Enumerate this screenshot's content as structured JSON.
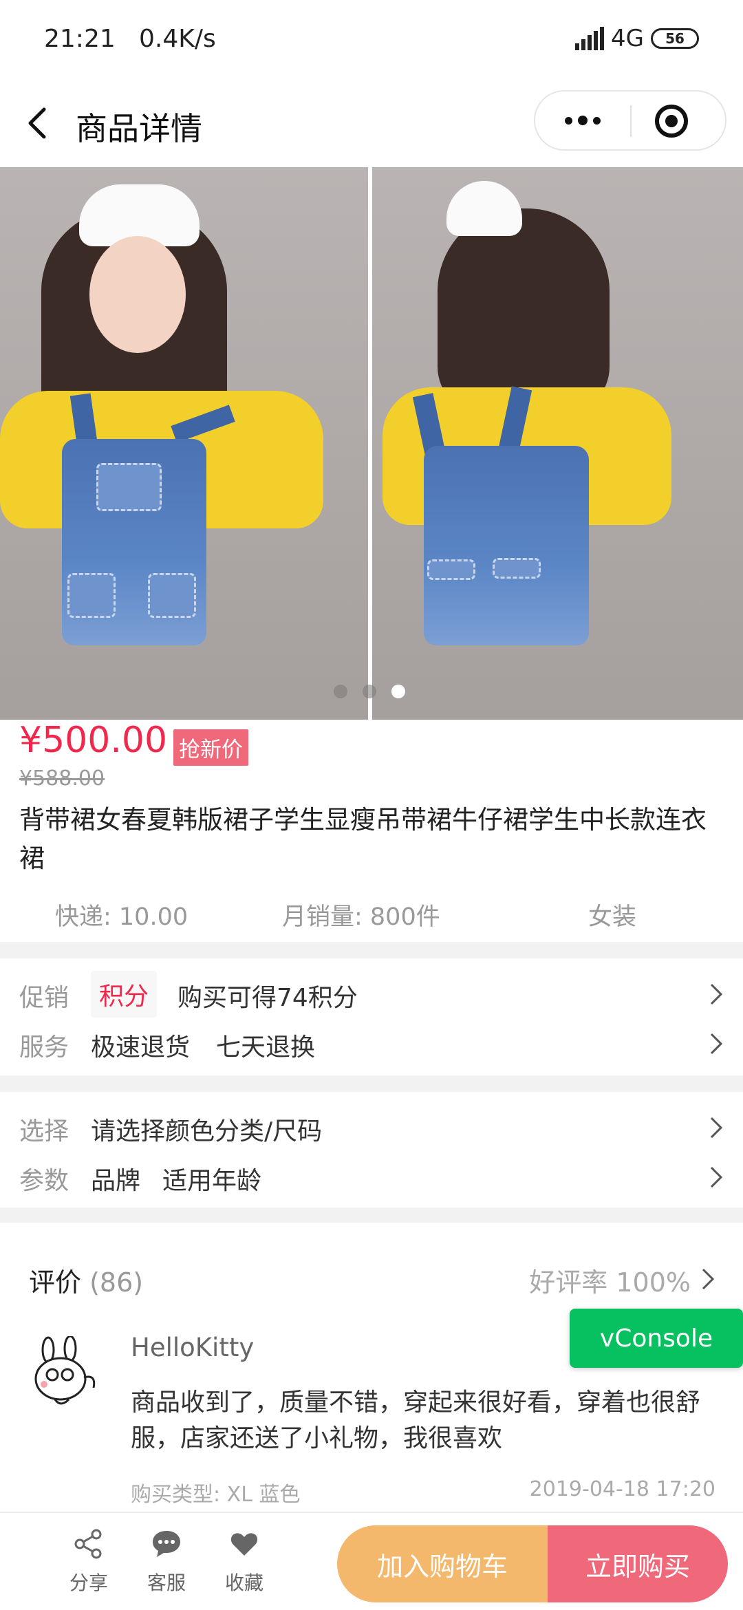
{
  "status": {
    "time": "21:21",
    "speed": "0.4K/s",
    "network": "4G",
    "battery": "56"
  },
  "nav": {
    "title": "商品详情"
  },
  "gallery": {
    "dots": 3,
    "active_dot": 3
  },
  "product": {
    "price": "¥500.00",
    "badge": "抢新价",
    "original_price": "¥588.00",
    "title": "背带裙女春夏韩版裙子学生显瘦吊带裙牛仔裙学生中长款连衣裙",
    "shipping": "快递: 10.00",
    "monthly_sales": "月销量: 800件",
    "category": "女装"
  },
  "promo": {
    "label": "促销",
    "tag": "积分",
    "text": "购买可得74积分"
  },
  "service": {
    "label": "服务",
    "items": [
      "极速退货",
      "七天退换"
    ]
  },
  "select": {
    "label": "选择",
    "text": "请选择颜色分类/尺码"
  },
  "params": {
    "label": "参数",
    "items": [
      "品牌",
      "适用年龄"
    ]
  },
  "reviews": {
    "title": "评价",
    "count": "(86)",
    "rate": "好评率 100%",
    "items": [
      {
        "user": "HelloKitty",
        "text": "商品收到了，质量不错，穿起来很好看，穿着也很舒服，店家还送了小礼物，我很喜欢",
        "type": "购买类型: XL 蓝色",
        "date": "2019-04-18 17:20"
      }
    ]
  },
  "vconsole": {
    "label": "vConsole"
  },
  "bottom": {
    "share": "分享",
    "service": "客服",
    "favorite": "收藏",
    "add_cart": "加入购物车",
    "buy_now": "立即购买"
  },
  "colors": {
    "price": "#f0284c",
    "cart": "#f3b86c",
    "buy": "#f0697a",
    "vconsole": "#07c160"
  }
}
